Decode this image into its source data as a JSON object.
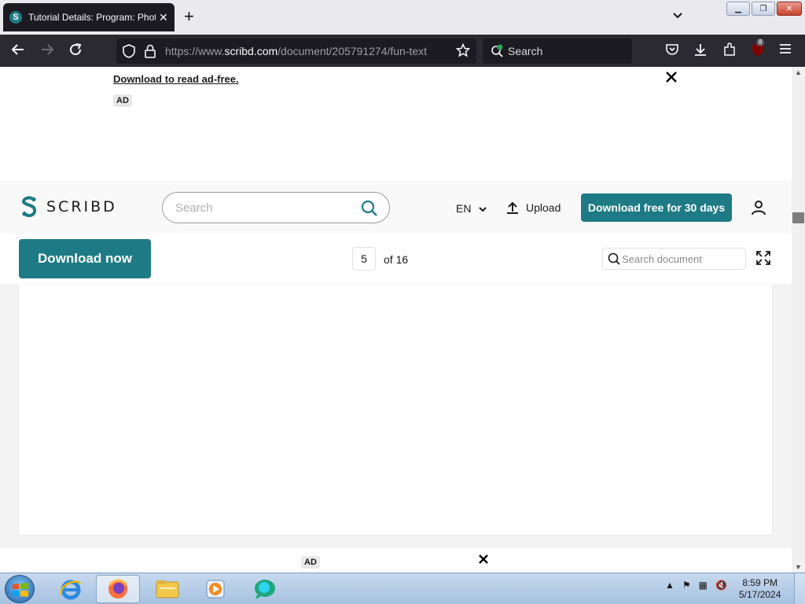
{
  "browser": {
    "tab_title": "Tutorial Details: Program: Phot",
    "new_tab_icon": "plus-icon",
    "url_prefix": "https://www.",
    "url_domain": "scribd.com",
    "url_path": "/document/205791274/fun-text",
    "search_placeholder": "Search",
    "extension_badge": "8"
  },
  "ad": {
    "link_text": "Download to read ad-free.",
    "tag": "AD"
  },
  "scribd": {
    "logo_text": "SCRIBD",
    "brand_color": "#1e7b85",
    "search_placeholder": "Search",
    "language": "EN",
    "upload_label": "Upload",
    "cta_label": "Download free for 30 days"
  },
  "doc_toolbar": {
    "download_label": "Download now",
    "current_page": "5",
    "total_pages": "of 16",
    "search_placeholder": "Search document"
  },
  "bottom_ad": {
    "tag": "AD"
  },
  "taskbar": {
    "time": "8:59 PM",
    "date": "5/17/2024"
  }
}
